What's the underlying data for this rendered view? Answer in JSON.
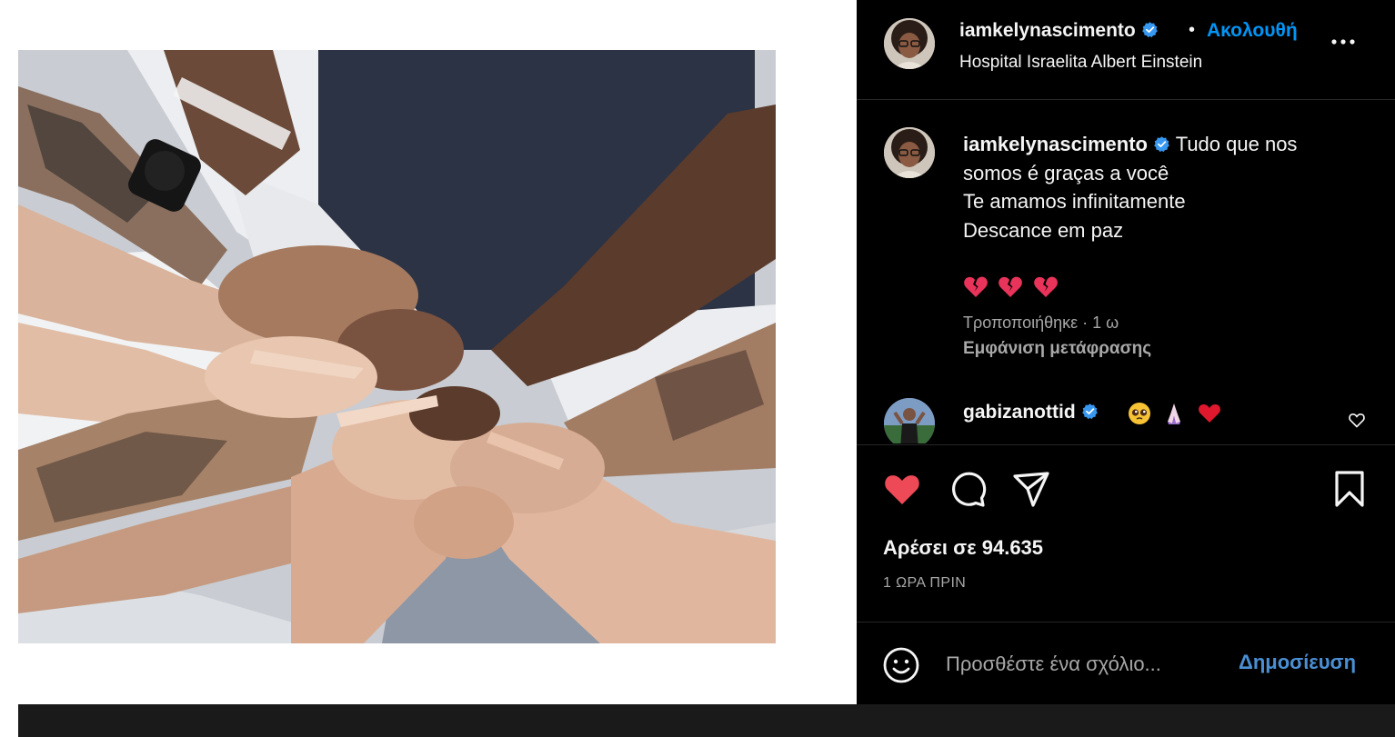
{
  "post": {
    "username": "iamkelynascimento",
    "follow_dot": "•",
    "follow_label": "Ακολουθή",
    "location": "Hospital Israelita Albert Einstein"
  },
  "caption": {
    "username": "iamkelynascimento",
    "lines": [
      "Tudo que nos",
      "somos é graças a você",
      "Te amamos infinitamente",
      "Descance em paz"
    ],
    "emojis": [
      "broken-heart",
      "broken-heart",
      "broken-heart"
    ],
    "edited": "Τροποποιήθηκε · 1 ω",
    "translate_label": "Εμφάνιση μετάφρασης"
  },
  "comment": {
    "username": "gabizanottid",
    "emojis": [
      "pleading-face",
      "folded-hands",
      "red-heart"
    ]
  },
  "actions": {
    "liked": true,
    "likes_text": "Αρέσει σε 94.635",
    "time_ago": "1 ΩΡΑ ΠΡΙΝ"
  },
  "composer": {
    "placeholder": "Προσθέστε ένα σχόλιο...",
    "post_label": "Δημοσίευση"
  },
  "colors": {
    "panel_bg": "#000000",
    "accent_blue": "#0095f6",
    "like_red": "#ed4956",
    "muted_text": "#a8a8a8",
    "verified_blue": "#3897f0"
  },
  "icons": [
    "verified-badge-icon",
    "more-options-icon",
    "heart-icon",
    "comment-icon",
    "share-icon",
    "bookmark-icon",
    "emoji-smiley-icon",
    "like-comment-icon"
  ]
}
